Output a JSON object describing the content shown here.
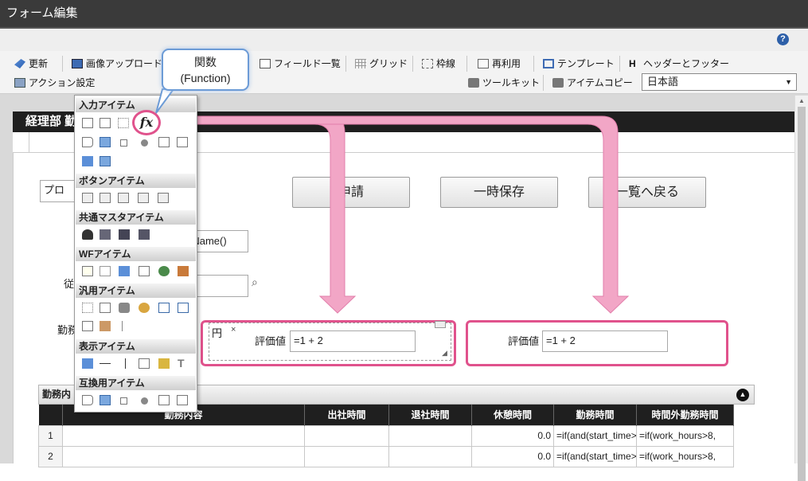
{
  "window": {
    "title": "フォーム編集"
  },
  "toolbar": {
    "row1": [
      {
        "label": "更新",
        "icon": "refresh-icon"
      },
      {
        "label": "画像アップロード",
        "icon": "image-upload-icon"
      },
      {
        "label": "フィールド一覧",
        "icon": "field-list-icon"
      },
      {
        "label": "グリッド",
        "icon": "grid-icon"
      },
      {
        "label": "枠線",
        "icon": "border-icon"
      },
      {
        "label": "再利用",
        "icon": "reuse-icon"
      },
      {
        "label": "テンプレート",
        "icon": "template-icon"
      },
      {
        "label": "ヘッダーとフッター",
        "icon": "header-footer-icon",
        "glyph": "H"
      }
    ],
    "row2": [
      {
        "label": "アクション設定",
        "icon": "action-icon"
      },
      {
        "label": "ツールキット",
        "icon": "toolkit-icon"
      },
      {
        "label": "アイテムコピー",
        "icon": "item-copy-icon"
      }
    ],
    "language": "日本語"
  },
  "help": "?",
  "callout": {
    "line1": "関数",
    "line2": "(Function)"
  },
  "fx_label": "fx",
  "form": {
    "title": "経理部 勤",
    "select_label": "プロ",
    "buttons": [
      "申請",
      "一時保存",
      "一覧へ戻る"
    ],
    "func_field": "rName()",
    "label_employee": "従",
    "label_work": "勤務",
    "unit": "円",
    "close_mark": "×",
    "eval_label": "評価値",
    "eval_value": "=1 + 2",
    "eval_label_2": "評価値",
    "eval_value_2": "=1 + 2"
  },
  "palette": {
    "categories": [
      "入力アイテム",
      "ボタンアイテム",
      "共通マスタアイテム",
      "WFアイテム",
      "汎用アイテム",
      "表示アイテム",
      "互換用アイテム"
    ]
  },
  "table": {
    "title": "勤務内",
    "columns": [
      "",
      "勤務内容",
      "出社時間",
      "退社時間",
      "休憩時間",
      "勤務時間",
      "時間外勤務時間"
    ],
    "rows": [
      [
        "1",
        "",
        "",
        "",
        "0.0",
        "=if(and(start_time>",
        "=if(work_hours>8,"
      ],
      [
        "2",
        "",
        "",
        "",
        "0.0",
        "=if(and(start_time>",
        "=if(work_hours>8,"
      ]
    ]
  },
  "colors": {
    "highlight": "#e0528c",
    "arrow": "#f2a6c6",
    "callout_border": "#6c9bd6",
    "header_bg": "#1f1f1f"
  }
}
